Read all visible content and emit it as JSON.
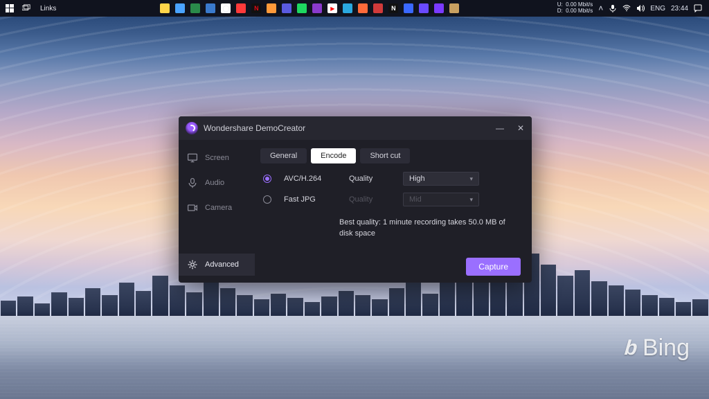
{
  "taskbar": {
    "links_label": "Links",
    "network": {
      "up_label": "U:",
      "down_label": "D:",
      "up": "0.00 Mbit/s",
      "down": "0.00 Mbit/s"
    },
    "lang": "ENG",
    "clock": "23:44"
  },
  "watermark": {
    "text": "Bing"
  },
  "window": {
    "title": "Wondershare DemoCreator",
    "sidebar": {
      "items": [
        {
          "label": "Screen"
        },
        {
          "label": "Audio"
        },
        {
          "label": "Camera"
        },
        {
          "label": "Advanced"
        }
      ]
    },
    "tabs": {
      "items": [
        {
          "label": "General"
        },
        {
          "label": "Encode"
        },
        {
          "label": "Short cut"
        }
      ]
    },
    "encode": {
      "avc_label": "AVC/H.264",
      "jpg_label": "Fast JPG",
      "quality_label": "Quality",
      "quality_label_disabled": "Quality",
      "quality_value": "High",
      "quality_disabled_value": "Mid",
      "note": "Best quality: 1 minute recording takes 50.0 MB of disk space"
    },
    "capture_label": "Capture"
  }
}
